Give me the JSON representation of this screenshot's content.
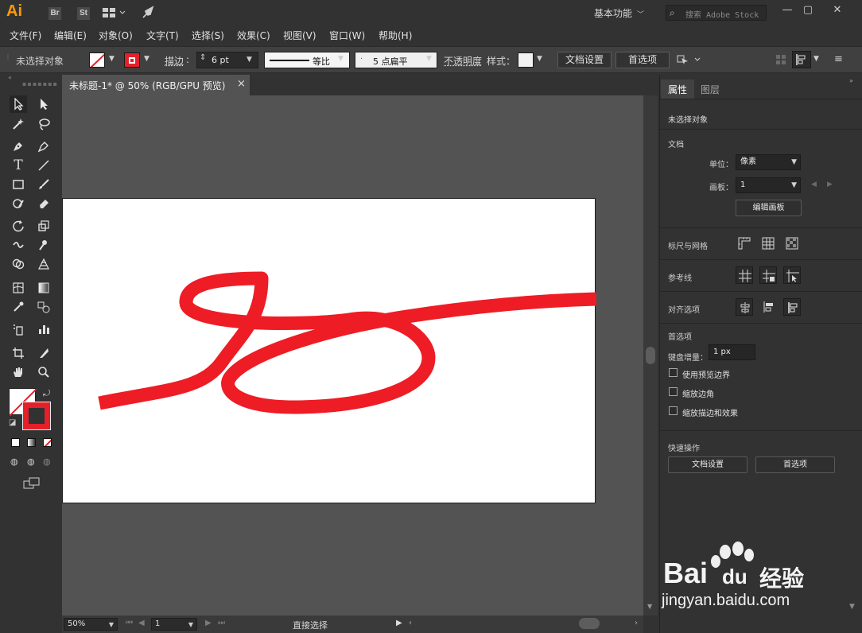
{
  "titlebar": {
    "app_logo": "Ai",
    "bridge_icon": "Br",
    "stock_icon": "St",
    "workspace": "基本功能",
    "search_placeholder": "搜索 Adobe Stock",
    "icons": [
      "arrange-documents-icon",
      "gpu-performance-icon",
      "minimize-icon",
      "maximize-icon",
      "close-icon"
    ]
  },
  "menu": [
    "文件(F)",
    "编辑(E)",
    "对象(O)",
    "文字(T)",
    "选择(S)",
    "效果(C)",
    "视图(V)",
    "窗口(W)",
    "帮助(H)"
  ],
  "controlbar": {
    "selection_status": "未选择对象",
    "stroke_label": "描边",
    "stroke_weight": "6 pt",
    "stroke_profile": "等比",
    "brush": "5 点扁平",
    "opacity_label": "不透明度",
    "style_label": "样式：",
    "doc_setup_button": "文档设置",
    "preferences_button": "首选项",
    "stroke_color": "#e5202b",
    "fill_color": "none"
  },
  "document": {
    "tab_title": "未标题-1* @ 50% (RGB/GPU 预览)",
    "artwork_color": "#ee1c25"
  },
  "statusbar": {
    "zoom": "50%",
    "artboard_number": "1",
    "current_tool": "直接选择"
  },
  "panel": {
    "tab_properties": "属性",
    "tab_layers": "图层",
    "selection_status": "未选择对象",
    "document_section": "文档",
    "units_label": "单位：",
    "units_value": "像素",
    "artboard_label": "画板：",
    "artboard_value": "1",
    "edit_artboards_button": "编辑画板",
    "rulers_grid_label": "标尺与网格",
    "guides_label": "参考线",
    "align_options_label": "对齐选项",
    "preferences_section": "首选项",
    "keyboard_increment_label": "键盘增量：",
    "keyboard_increment_value": "1 px",
    "checkboxes": [
      {
        "label": "使用预览边界",
        "checked": false
      },
      {
        "label": "缩放边角",
        "checked": false
      },
      {
        "label": "缩放描边和效果",
        "checked": false
      }
    ],
    "quick_actions_label": "快速操作",
    "quick_doc_setup_button": "文档设置",
    "quick_preferences_button": "首选项"
  },
  "watermark": {
    "brand": "Bai",
    "brand2": "du",
    "brand_cn": "经验",
    "url": "jingyan.baidu.com"
  }
}
